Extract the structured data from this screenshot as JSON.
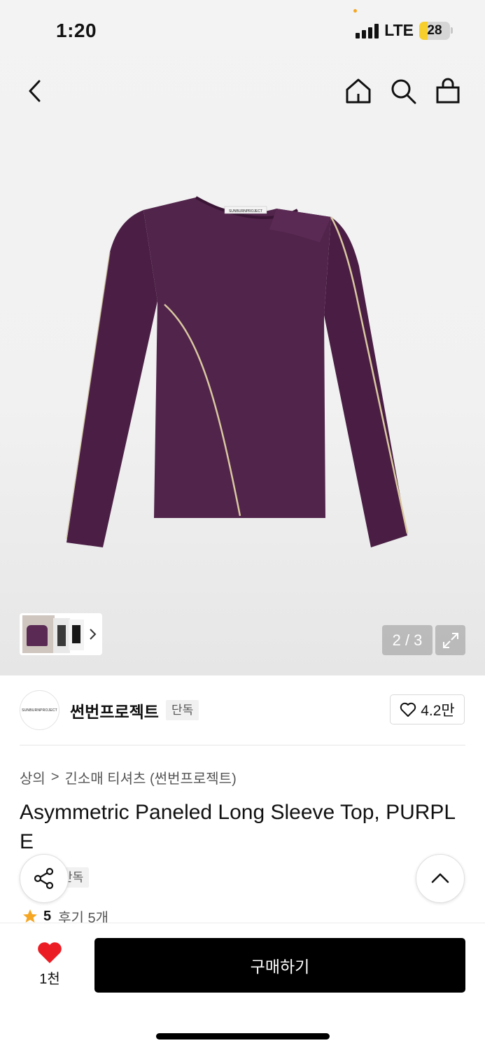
{
  "status_bar": {
    "time": "1:20",
    "network": "LTE",
    "battery": "28",
    "battery_level": 0.28
  },
  "nav": {
    "back": "chevron-left-icon",
    "home": "home-icon",
    "search": "search-icon",
    "cart": "shopping-bag-icon"
  },
  "gallery": {
    "counter": "2 / 3",
    "product_label_text": "SUNBURNPROJECT"
  },
  "brand": {
    "logo_text": "SUNBURNPROJECT",
    "name": "썬번프로젝트",
    "badge": "단독",
    "likes": "4.2만"
  },
  "breadcrumb": {
    "category": "상의",
    "separator": ">",
    "subcategory": "긴소매 티셔츠 (썬번프로젝트)"
  },
  "product": {
    "title": "Asymmetric Paneled Long Sleeve Top, PURPLE",
    "badge": "단독"
  },
  "rating": {
    "score": "5",
    "reviews": "후기 5개"
  },
  "bottom_bar": {
    "wish_count": "1천",
    "buy_label": "구매하기"
  },
  "colors": {
    "product": "#4b1f45",
    "piping": "#d9c9a0",
    "heart": "#ec1c24",
    "star": "#f5a623",
    "buy_button": "#000000"
  }
}
